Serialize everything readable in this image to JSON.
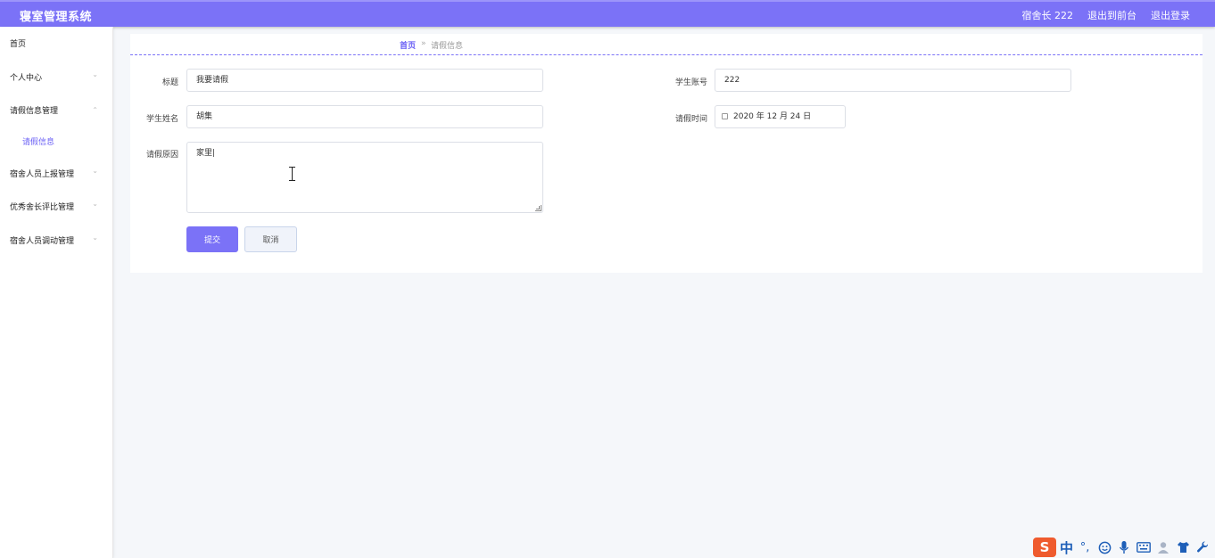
{
  "header": {
    "app_title": "寝室管理系统",
    "user_label": "宿舍长 222",
    "to_front_label": "退出到前台",
    "logout_label": "退出登录",
    "accent_color": "#7b72f7"
  },
  "sidebar": {
    "items": [
      {
        "label": "首页",
        "has_chevron": false
      },
      {
        "label": "个人中心",
        "chevron": "⌄"
      },
      {
        "label": "请假信息管理",
        "chevron": "⌃"
      },
      {
        "label": "请假信息",
        "submenu": true
      },
      {
        "label": "宿舍人员上报管理",
        "chevron": "⌄"
      },
      {
        "label": "优秀舍长评比管理",
        "chevron": "⌄"
      },
      {
        "label": "宿舍人员调动管理",
        "chevron": "⌄"
      }
    ]
  },
  "breadcrumb": {
    "home": "首页",
    "separator": "»",
    "current": "请假信息"
  },
  "form": {
    "title_label": "标题",
    "title_value": "我要请假",
    "student_account_label": "学生账号",
    "student_account_value": "222",
    "student_name_label": "学生姓名",
    "student_name_value": "胡集",
    "leave_time_label": "请假时间",
    "leave_time_value": "2020 年 12 月 24 日",
    "leave_reason_label": "请假原因",
    "leave_reason_value": "家里|",
    "submit_label": "提交",
    "cancel_label": "取消"
  },
  "ime": {
    "logo": "S",
    "mode": "中",
    "punct": "°,",
    "icons": [
      "smiley-icon",
      "microphone-icon",
      "keyboard-icon",
      "user-icon",
      "shirt-icon",
      "wrench-icon"
    ]
  }
}
